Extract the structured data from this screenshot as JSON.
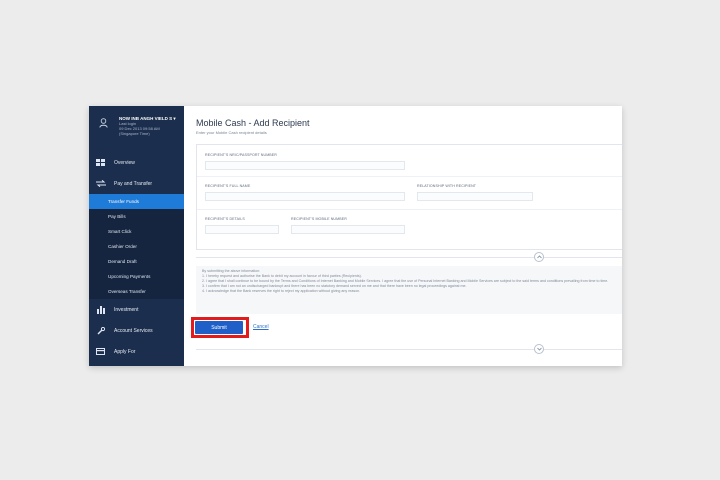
{
  "sidebar": {
    "profile": {
      "name": "NOW INB ANGH VIELD S ▾",
      "meta_lines": [
        "Last login",
        "09 Dec 2013 09:58 AM",
        "(Singapore Time)"
      ]
    },
    "items": [
      {
        "label": "Overview",
        "icon": "grid-icon"
      },
      {
        "label": "Pay and Transfer",
        "icon": "transfer-arrows-icon"
      }
    ],
    "sub_items": [
      {
        "label": "Transfer Funds",
        "active": true
      },
      {
        "label": "Pay Bills",
        "active": false
      },
      {
        "label": "Smart Click",
        "active": false
      },
      {
        "label": "Cashier Order",
        "active": false
      },
      {
        "label": "Demand Draft",
        "active": false
      },
      {
        "label": "Upcoming Payments",
        "active": false
      },
      {
        "label": "Overseas Transfer",
        "active": false
      }
    ],
    "bottom_items": [
      {
        "label": "Investment",
        "icon": "building-icon"
      },
      {
        "label": "Account Services",
        "icon": "wrench-icon"
      },
      {
        "label": "Apply For",
        "icon": "card-icon"
      }
    ]
  },
  "main": {
    "title": "Mobile Cash - Add Recipient",
    "subtitle": "Enter your Mobile Cash recipient details",
    "fields": {
      "nric": "RECIPIENT'S NRIC/PASSPORT NUMBER",
      "full_name": "RECIPIENT'S FULL NAME",
      "relationship": "RELATIONSHIP WITH RECIPIENT",
      "details": "RECIPIENT'S DETAILS",
      "mobile": "RECIPIENT'S MOBILE NUMBER"
    },
    "terms": {
      "intro": "By submitting the above information:",
      "lines": [
        "1. I hereby request and authorise the Bank to debit my account in favour of third parties (Recipients).",
        "2. I agree that I shall continue to be bound by the Terms and Conditions of Internet Banking and Mobile Services. I agree that the use of Personal Internet Banking and Mobile Services are subject to the said terms and conditions prevailing from time to time.",
        "3. I confirm that I am not an undischarged bankrupt and there has been no statutory demand served on me and that there have been no legal proceedings against me.",
        "4. I acknowledge that the Bank reserves the right to reject my application without giving any reason."
      ]
    },
    "actions": {
      "submit": "Submit",
      "cancel": "Cancel"
    }
  },
  "colors": {
    "sidebar_bg": "#1c2e4d",
    "active_item": "#1f7bd8",
    "primary_button": "#1f5fc7",
    "highlight_border": "#e41b1b"
  }
}
